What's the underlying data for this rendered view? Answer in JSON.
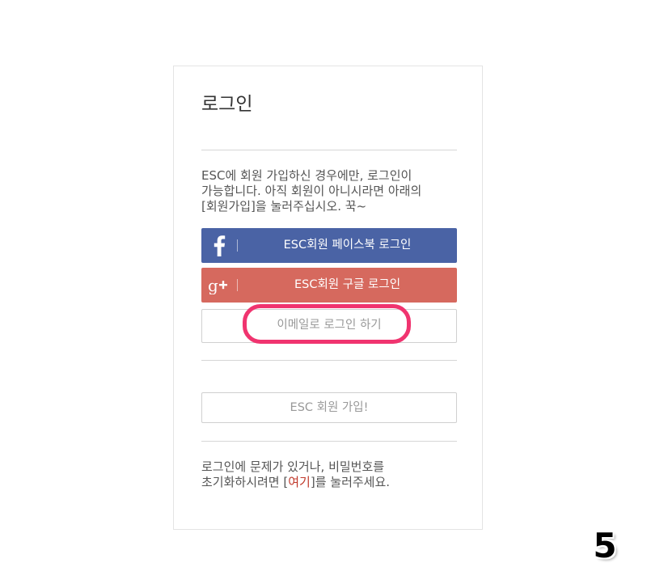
{
  "login_card": {
    "title": "로그인",
    "notice": "ESC에 회원 가입하신 경우에만, 로그인이 가능합니다. 아직 회원이 아니시라면 아래의 [회원가입]을 눌러주십시오. 꾹~",
    "facebook_button": {
      "label": "ESC회원 페이스북 로그인",
      "icon": "facebook-icon",
      "color": "#4a63a5"
    },
    "google_button": {
      "label": "ESC회원 구글 로그인",
      "icon": "google-plus-icon",
      "color": "#d6695e"
    },
    "email_button": {
      "label": "이메일로 로그인 하기"
    },
    "join_button": {
      "label": "ESC 회원 가입!"
    },
    "help": {
      "prefix": "로그인에 문제가 있거나, 비밀번호를 초기화하시려면 [",
      "link_text": "여기",
      "suffix": "]를 눌러주세요."
    }
  },
  "annotation": {
    "step_number": "5",
    "highlight_color": "#f0346f"
  }
}
